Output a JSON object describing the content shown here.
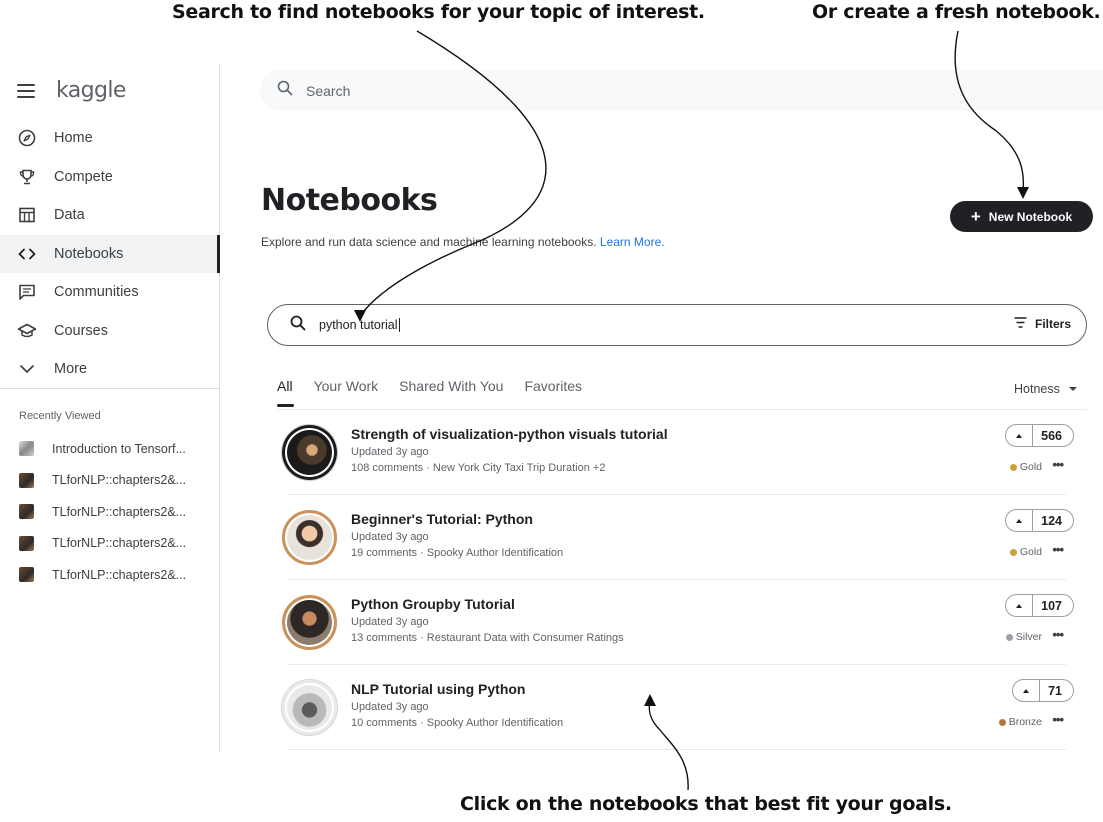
{
  "annotations": {
    "search": "Search to find notebooks for your topic of interest.",
    "create": "Or create a fresh notebook.",
    "click": "Click on the notebooks that best fit your goals."
  },
  "sidebar": {
    "logo": "kaggle",
    "nav": [
      {
        "label": "Home",
        "icon": "compass-icon"
      },
      {
        "label": "Compete",
        "icon": "trophy-icon"
      },
      {
        "label": "Data",
        "icon": "table-icon"
      },
      {
        "label": "Notebooks",
        "icon": "code-icon",
        "active": true
      },
      {
        "label": "Communities",
        "icon": "comment-icon"
      },
      {
        "label": "Courses",
        "icon": "school-icon"
      },
      {
        "label": "More",
        "icon": "chevron-down-icon"
      }
    ],
    "recent_title": "Recently Viewed",
    "recent": [
      "Introduction to Tensorf...",
      "TLforNLP::chapters2&...",
      "TLforNLP::chapters2&...",
      "TLforNLP::chapters2&...",
      "TLforNLP::chapters2&..."
    ]
  },
  "top_search": {
    "placeholder": "Search"
  },
  "header": {
    "title": "Notebooks",
    "subtitle": "Explore and run data science and machine learning notebooks.",
    "learn_more": "Learn More.",
    "new_button": "New Notebook"
  },
  "notebook_search": {
    "query": "python tutorial",
    "filters_label": "Filters"
  },
  "tabs": [
    "All",
    "Your Work",
    "Shared With You",
    "Favorites"
  ],
  "active_tab": "All",
  "sort": "Hotness",
  "notebooks": [
    {
      "title": "Strength of visualization-python visuals tutorial",
      "updated": "Updated 3y ago",
      "meta": "108 comments · New York City Taxi Trip Duration +2",
      "votes": "566",
      "medal": "Gold",
      "medal_color": "#c9a13b"
    },
    {
      "title": "Beginner's Tutorial: Python",
      "updated": "Updated 3y ago",
      "meta": "19 comments · Spooky Author Identification",
      "votes": "124",
      "medal": "Gold",
      "medal_color": "#c9a13b"
    },
    {
      "title": "Python Groupby Tutorial",
      "updated": "Updated 3y ago",
      "meta": "13 comments · Restaurant Data with Consumer Ratings",
      "votes": "107",
      "medal": "Silver",
      "medal_color": "#9aa0a6"
    },
    {
      "title": "NLP Tutorial using Python",
      "updated": "Updated 3y ago",
      "meta": "10 comments · Spooky Author Identification",
      "votes": "71",
      "medal": "Bronze",
      "medal_color": "#b5743a"
    }
  ]
}
